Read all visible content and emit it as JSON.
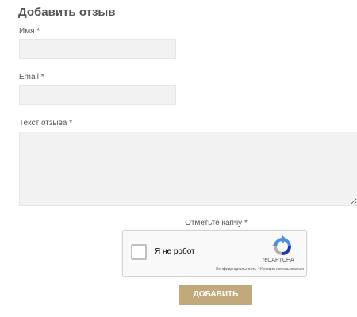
{
  "form": {
    "title": "Добавить отзыв",
    "name_label": "Имя *",
    "name_value": "",
    "email_label": "Email *",
    "email_value": "",
    "review_label": "Текст отзыва *",
    "review_value": "",
    "captcha_label": "Отметьте капчу *",
    "submit_label": "ДОБАВИТЬ"
  },
  "recaptcha": {
    "checkbox_label": "Я не робот",
    "brand": "reCAPTCHA",
    "privacy_link": "Конфиденциальность",
    "separator": " • ",
    "terms_link": "Условия использования",
    "checked": false
  },
  "colors": {
    "input_bg": "#f2f2f2",
    "button_bg": "#c2a97b",
    "button_text": "#ffffff",
    "title": "#555555"
  }
}
